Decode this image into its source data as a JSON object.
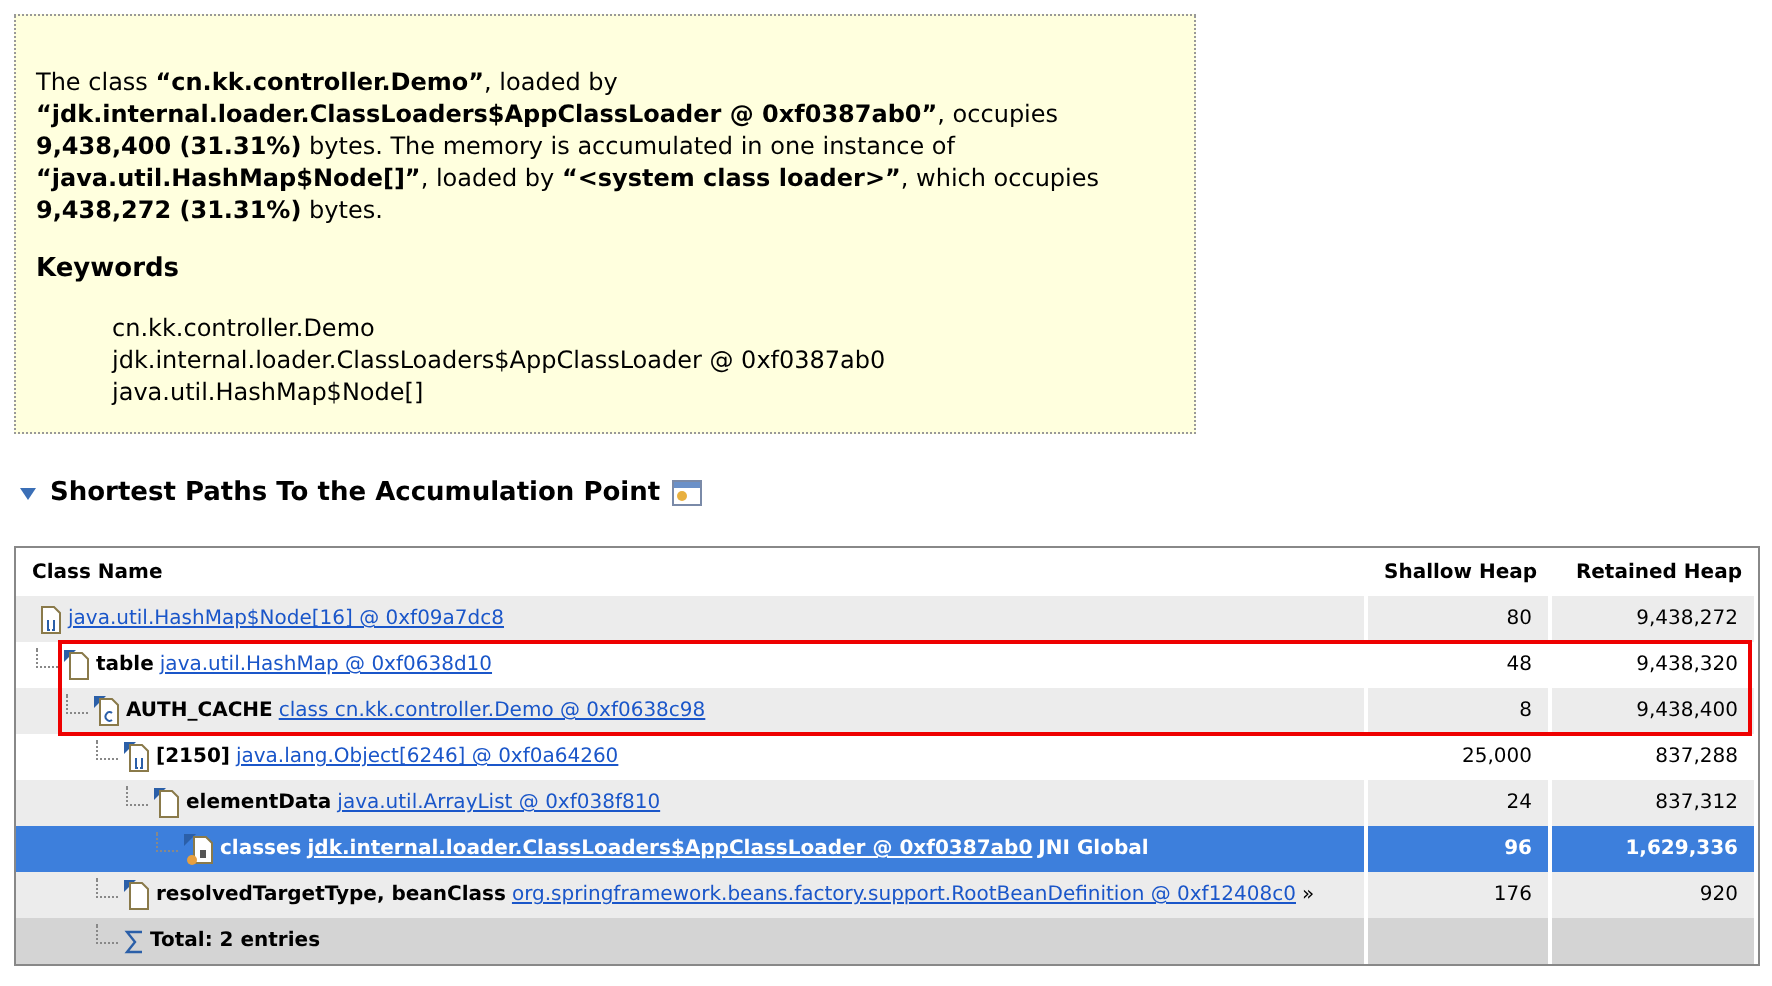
{
  "description": {
    "text": "The class **“cn.kk.controller.Demo”**, loaded by **“jdk.internal.loader.ClassLoaders$AppClassLoader @ 0xf0387ab0”**, occupies **9,438,400 (31.31%)** bytes. The memory is accumulated in one instance of **“java.util.HashMap$Node[]”**, loaded by **“<system class loader>”**, which occupies **9,438,272 (31.31%)** bytes.",
    "keywords_title": "Keywords",
    "keywords": [
      "cn.kk.controller.Demo",
      "jdk.internal.loader.ClassLoaders$AppClassLoader @ 0xf0387ab0",
      "java.util.HashMap$Node[]"
    ]
  },
  "section": {
    "title": "Shortest Paths To the Accumulation Point",
    "expanded": true
  },
  "table": {
    "columns": [
      "Class Name",
      "Shallow Heap",
      "Retained Heap"
    ],
    "rows": [
      {
        "kind": "array",
        "link": "java.util.HashMap$Node[16] @ 0xf09a7dc8",
        "shallow": "80",
        "retained": "9,438,272",
        "selected": false,
        "children": [
          {
            "kind": "object",
            "label": "table",
            "link": "java.util.HashMap @ 0xf0638d10",
            "shallow": "48",
            "retained": "9,438,320",
            "selected": false,
            "outlined": true,
            "children": [
              {
                "kind": "class",
                "label": "AUTH_CACHE",
                "link": "class cn.kk.controller.Demo @ 0xf0638c98",
                "shallow": "8",
                "retained": "9,438,400",
                "selected": false,
                "outlined": true,
                "children": [
                  {
                    "kind": "array",
                    "label": "[2150]",
                    "link": "java.lang.Object[6246] @ 0xf0a64260",
                    "shallow": "25,000",
                    "retained": "837,288",
                    "selected": false,
                    "children": [
                      {
                        "kind": "object",
                        "label": "elementData",
                        "link": "java.util.ArrayList @ 0xf038f810",
                        "shallow": "24",
                        "retained": "837,312",
                        "selected": false,
                        "children": [
                          {
                            "kind": "classloader",
                            "label": "classes",
                            "link": "jdk.internal.loader.ClassLoaders$AppClassLoader @ 0xf0387ab0",
                            "suffix": "JNI Global",
                            "shallow": "96",
                            "retained": "1,629,336",
                            "selected": true
                          }
                        ]
                      }
                    ]
                  },
                  {
                    "kind": "object",
                    "label": "resolvedTargetType, beanClass",
                    "link": "org.springframework.beans.factory.support.RootBeanDefinition @ 0xf12408c0",
                    "suffix": "»",
                    "shallow": "176",
                    "retained": "920",
                    "selected": false
                  },
                  {
                    "kind": "sum",
                    "label": "Total: 2 entries",
                    "selected": false
                  }
                ]
              }
            ]
          }
        ]
      }
    ]
  }
}
